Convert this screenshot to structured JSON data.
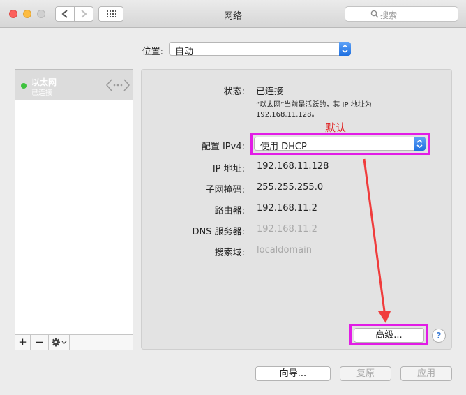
{
  "window": {
    "title": "网络"
  },
  "search": {
    "placeholder": "搜索"
  },
  "location": {
    "label": "位置:",
    "value": "自动"
  },
  "sidebar": {
    "items": [
      {
        "name": "以太网",
        "status": "已连接"
      }
    ],
    "add_label": "+",
    "remove_label": "−"
  },
  "detail": {
    "status_label": "状态:",
    "status_value": "已连接",
    "status_desc_line1": "“以太网”当前是活跃的，其 IP 地址为",
    "status_desc_line2": "192.168.11.128。",
    "configure_label": "配置 IPv4:",
    "configure_value": "使用 DHCP",
    "ip_label": "IP 地址:",
    "ip_value": "192.168.11.128",
    "subnet_label": "子网掩码:",
    "subnet_value": "255.255.255.0",
    "router_label": "路由器:",
    "router_value": "192.168.11.2",
    "dns_label": "DNS 服务器:",
    "dns_value": "192.168.11.2",
    "search_domain_label": "搜索域:",
    "search_domain_value": "localdomain",
    "advanced_label": "高级...",
    "help_label": "?"
  },
  "annotation": {
    "text": "默认",
    "color": "#e02020",
    "box_color": "#e21ce6"
  },
  "bottom": {
    "assistant_label": "向导...",
    "revert_label": "复原",
    "apply_label": "应用"
  },
  "colors": {
    "status_green": "#3ec23e",
    "accent_blue": "#1e6fe0"
  }
}
